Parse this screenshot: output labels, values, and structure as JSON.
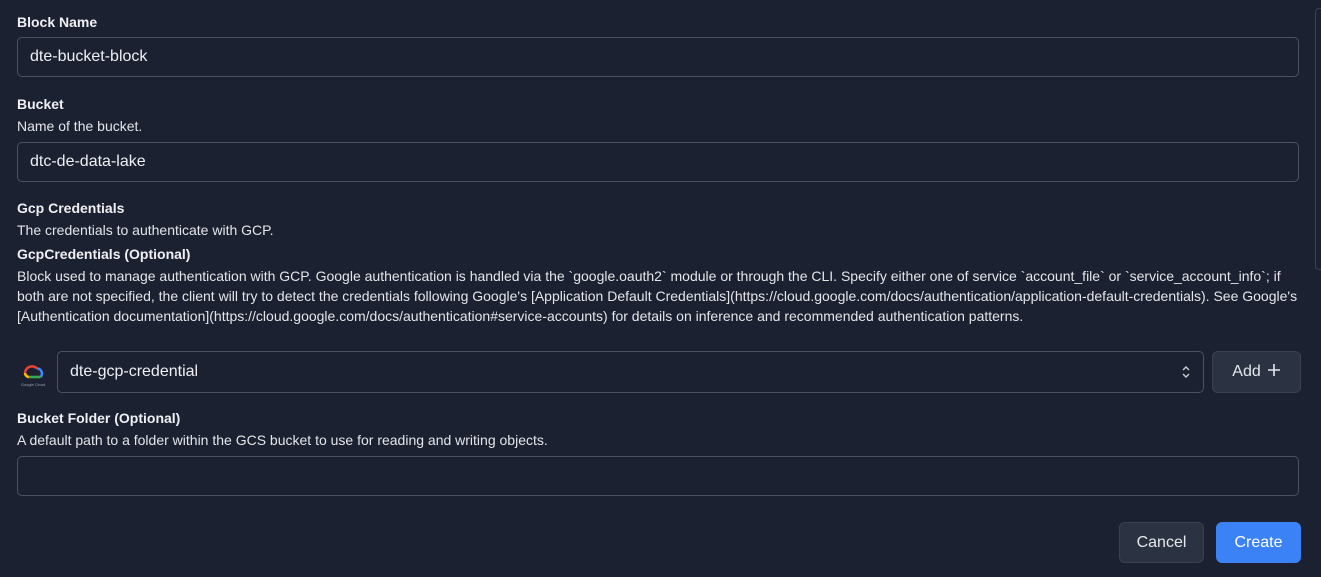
{
  "block_name": {
    "label": "Block Name",
    "value": "dte-bucket-block"
  },
  "bucket": {
    "label": "Bucket",
    "description": "Name of the bucket.",
    "value": "dtc-de-data-lake"
  },
  "gcp_credentials": {
    "label": "Gcp Credentials",
    "description": "The credentials to authenticate with GCP.",
    "sub_label": "GcpCredentials (Optional)",
    "sub_description": "Block used to manage authentication with GCP. Google authentication is handled via the `google.oauth2` module or through the CLI. Specify either one of service `account_file` or `service_account_info`; if both are not specified, the client will try to detect the credentials following Google's [Application Default Credentials](https://cloud.google.com/docs/authentication/application-default-credentials). See Google's [Authentication documentation](https://cloud.google.com/docs/authentication#service-accounts) for details on inference and recommended authentication patterns.",
    "selected": "dte-gcp-credential",
    "logo_text": "Google Cloud",
    "add_label": "Add"
  },
  "bucket_folder": {
    "label": "Bucket Folder (Optional)",
    "description": "A default path to a folder within the GCS bucket to use for reading and writing objects.",
    "value": ""
  },
  "actions": {
    "cancel_label": "Cancel",
    "create_label": "Create"
  },
  "colors": {
    "background": "#1b2130",
    "border": "#4a5263",
    "primary": "#3b82f6",
    "secondary_button": "#2b3342"
  },
  "icons": {
    "logo": "google-cloud-icon",
    "select_chevron": "chevron-up-down-icon",
    "add": "plus-icon"
  }
}
